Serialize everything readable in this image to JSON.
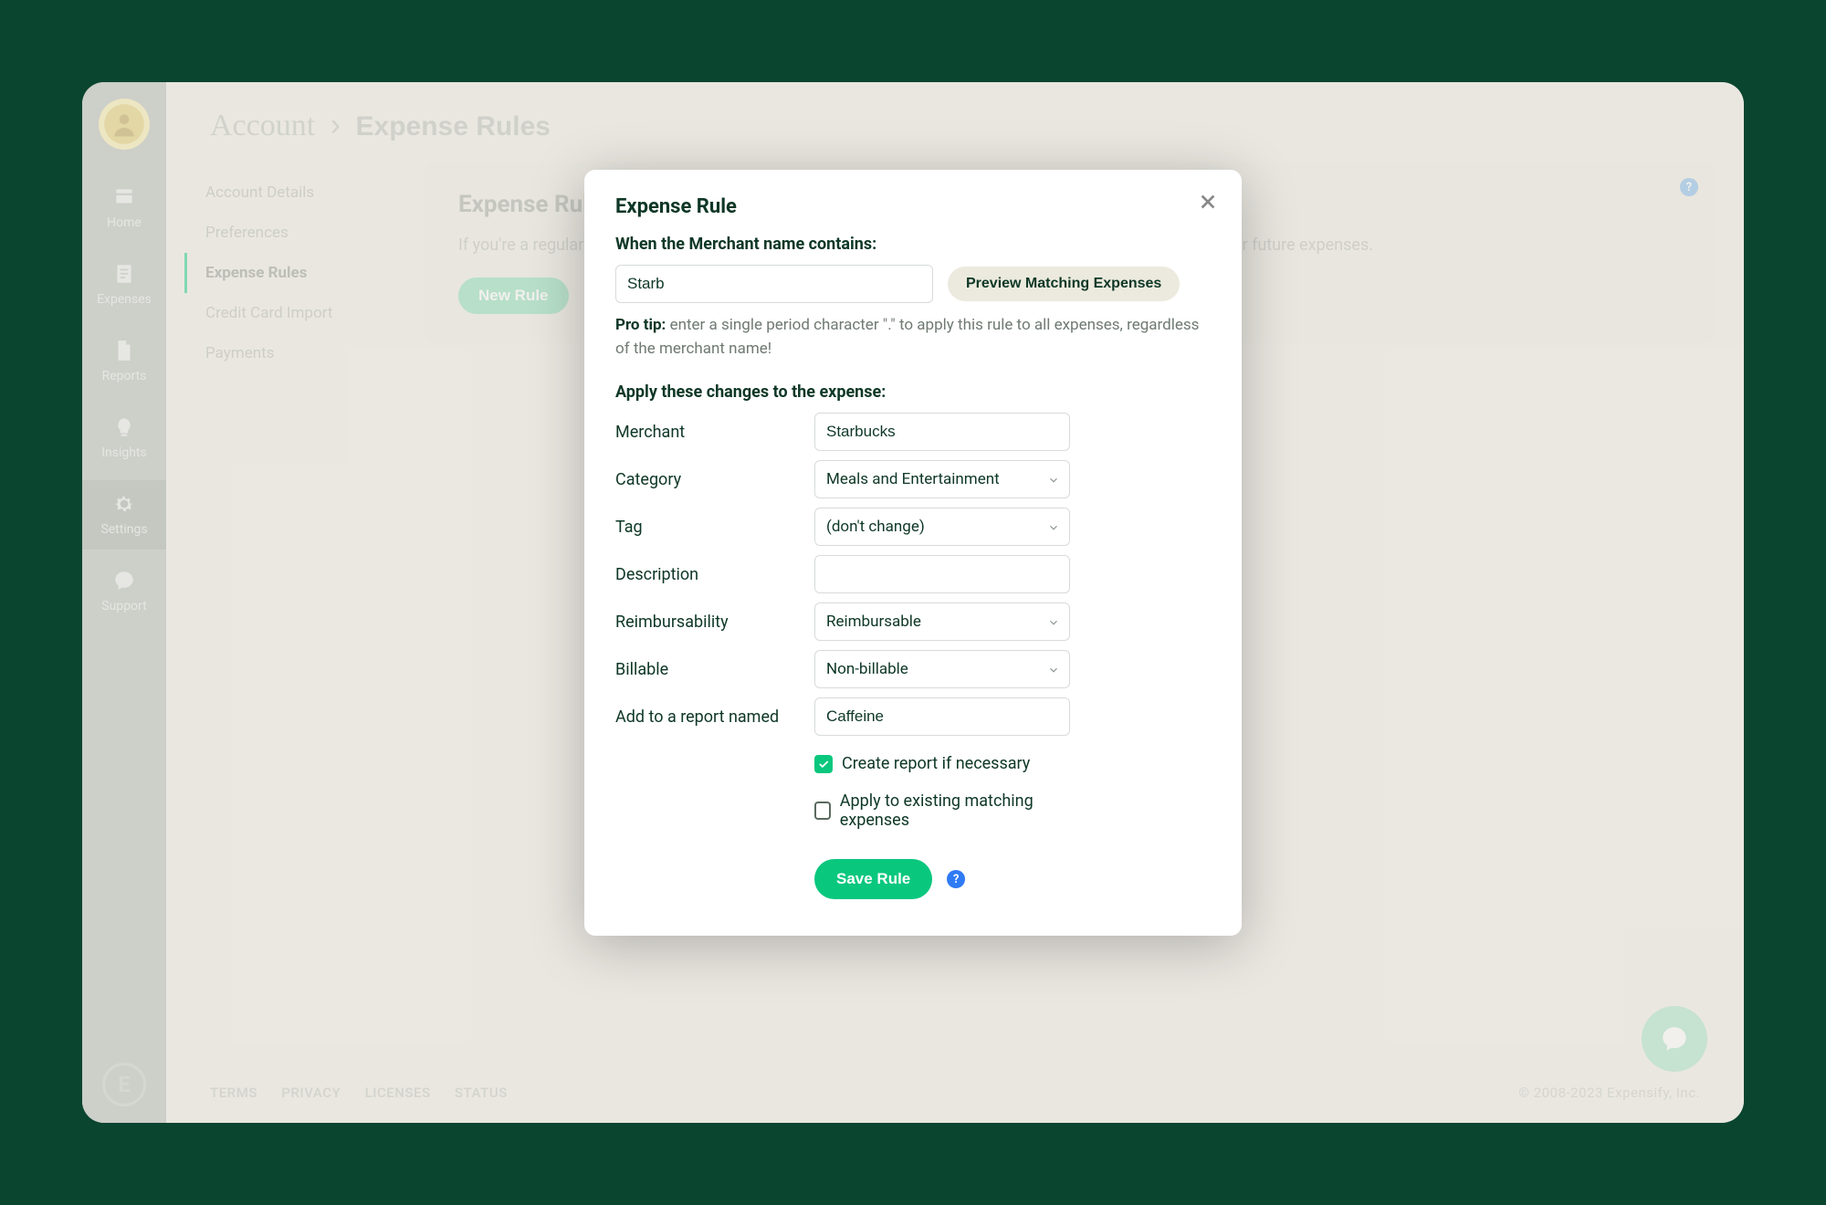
{
  "breadcrumb": {
    "root": "Account",
    "current": "Expense Rules"
  },
  "sidebar": {
    "items": [
      {
        "label": "Home"
      },
      {
        "label": "Expenses"
      },
      {
        "label": "Reports"
      },
      {
        "label": "Insights"
      },
      {
        "label": "Settings"
      },
      {
        "label": "Support"
      }
    ]
  },
  "subsidebar": {
    "items": [
      {
        "label": "Account Details"
      },
      {
        "label": "Preferences"
      },
      {
        "label": "Expense Rules"
      },
      {
        "label": "Credit Card Import"
      },
      {
        "label": "Payments"
      }
    ]
  },
  "content": {
    "title": "Expense Rules",
    "description": "If you're a regular at a store or merchant, you can use auto complete category, tag, and other changes to your future expenses.",
    "new_rule_label": "New Rule"
  },
  "footer": {
    "links": [
      "TERMS",
      "PRIVACY",
      "LICENSES",
      "STATUS"
    ],
    "copyright": "© 2008-2023 Expensify, Inc."
  },
  "modal": {
    "title": "Expense Rule",
    "section1_title": "When the Merchant name contains:",
    "merchant_contains_value": "Starb",
    "preview_button": "Preview Matching Expenses",
    "pro_tip_label": "Pro tip:",
    "pro_tip_text": " enter a single period character \".\" to apply this rule to all expenses, regardless of the merchant name!",
    "section2_title": "Apply these changes to the expense:",
    "fields": {
      "merchant": {
        "label": "Merchant",
        "value": "Starbucks"
      },
      "category": {
        "label": "Category",
        "value": "Meals and Entertainment"
      },
      "tag": {
        "label": "Tag",
        "value": "(don't change)"
      },
      "description": {
        "label": "Description",
        "value": ""
      },
      "reimbursability": {
        "label": "Reimbursability",
        "value": "Reimbursable"
      },
      "billable": {
        "label": "Billable",
        "value": "Non-billable"
      },
      "add_to_report": {
        "label": "Add to a report named",
        "value": "Caffeine"
      }
    },
    "checkbox_create_report": "Create report if necessary",
    "checkbox_apply_existing": "Apply to existing matching expenses",
    "save_button": "Save Rule"
  }
}
